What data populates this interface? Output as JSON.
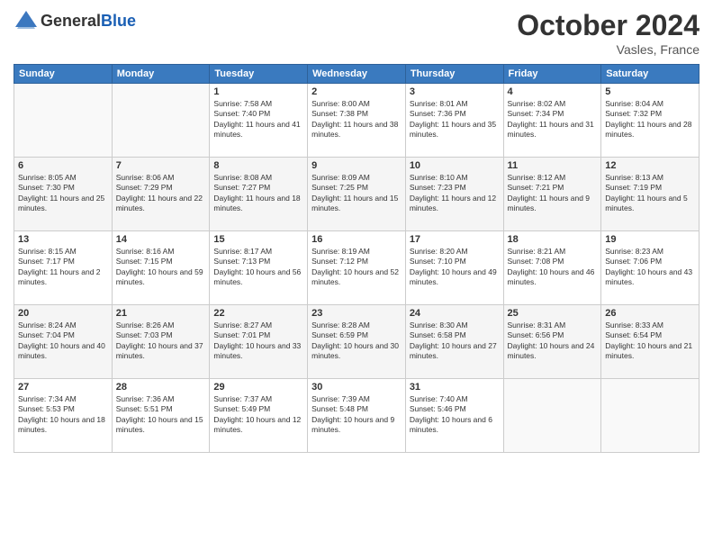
{
  "header": {
    "logo_general": "General",
    "logo_blue": "Blue",
    "month_title": "October 2024",
    "location": "Vasles, France"
  },
  "weekdays": [
    "Sunday",
    "Monday",
    "Tuesday",
    "Wednesday",
    "Thursday",
    "Friday",
    "Saturday"
  ],
  "weeks": [
    [
      {
        "day": "",
        "info": ""
      },
      {
        "day": "",
        "info": ""
      },
      {
        "day": "1",
        "info": "Sunrise: 7:58 AM\nSunset: 7:40 PM\nDaylight: 11 hours and 41 minutes."
      },
      {
        "day": "2",
        "info": "Sunrise: 8:00 AM\nSunset: 7:38 PM\nDaylight: 11 hours and 38 minutes."
      },
      {
        "day": "3",
        "info": "Sunrise: 8:01 AM\nSunset: 7:36 PM\nDaylight: 11 hours and 35 minutes."
      },
      {
        "day": "4",
        "info": "Sunrise: 8:02 AM\nSunset: 7:34 PM\nDaylight: 11 hours and 31 minutes."
      },
      {
        "day": "5",
        "info": "Sunrise: 8:04 AM\nSunset: 7:32 PM\nDaylight: 11 hours and 28 minutes."
      }
    ],
    [
      {
        "day": "6",
        "info": "Sunrise: 8:05 AM\nSunset: 7:30 PM\nDaylight: 11 hours and 25 minutes."
      },
      {
        "day": "7",
        "info": "Sunrise: 8:06 AM\nSunset: 7:29 PM\nDaylight: 11 hours and 22 minutes."
      },
      {
        "day": "8",
        "info": "Sunrise: 8:08 AM\nSunset: 7:27 PM\nDaylight: 11 hours and 18 minutes."
      },
      {
        "day": "9",
        "info": "Sunrise: 8:09 AM\nSunset: 7:25 PM\nDaylight: 11 hours and 15 minutes."
      },
      {
        "day": "10",
        "info": "Sunrise: 8:10 AM\nSunset: 7:23 PM\nDaylight: 11 hours and 12 minutes."
      },
      {
        "day": "11",
        "info": "Sunrise: 8:12 AM\nSunset: 7:21 PM\nDaylight: 11 hours and 9 minutes."
      },
      {
        "day": "12",
        "info": "Sunrise: 8:13 AM\nSunset: 7:19 PM\nDaylight: 11 hours and 5 minutes."
      }
    ],
    [
      {
        "day": "13",
        "info": "Sunrise: 8:15 AM\nSunset: 7:17 PM\nDaylight: 11 hours and 2 minutes."
      },
      {
        "day": "14",
        "info": "Sunrise: 8:16 AM\nSunset: 7:15 PM\nDaylight: 10 hours and 59 minutes."
      },
      {
        "day": "15",
        "info": "Sunrise: 8:17 AM\nSunset: 7:13 PM\nDaylight: 10 hours and 56 minutes."
      },
      {
        "day": "16",
        "info": "Sunrise: 8:19 AM\nSunset: 7:12 PM\nDaylight: 10 hours and 52 minutes."
      },
      {
        "day": "17",
        "info": "Sunrise: 8:20 AM\nSunset: 7:10 PM\nDaylight: 10 hours and 49 minutes."
      },
      {
        "day": "18",
        "info": "Sunrise: 8:21 AM\nSunset: 7:08 PM\nDaylight: 10 hours and 46 minutes."
      },
      {
        "day": "19",
        "info": "Sunrise: 8:23 AM\nSunset: 7:06 PM\nDaylight: 10 hours and 43 minutes."
      }
    ],
    [
      {
        "day": "20",
        "info": "Sunrise: 8:24 AM\nSunset: 7:04 PM\nDaylight: 10 hours and 40 minutes."
      },
      {
        "day": "21",
        "info": "Sunrise: 8:26 AM\nSunset: 7:03 PM\nDaylight: 10 hours and 37 minutes."
      },
      {
        "day": "22",
        "info": "Sunrise: 8:27 AM\nSunset: 7:01 PM\nDaylight: 10 hours and 33 minutes."
      },
      {
        "day": "23",
        "info": "Sunrise: 8:28 AM\nSunset: 6:59 PM\nDaylight: 10 hours and 30 minutes."
      },
      {
        "day": "24",
        "info": "Sunrise: 8:30 AM\nSunset: 6:58 PM\nDaylight: 10 hours and 27 minutes."
      },
      {
        "day": "25",
        "info": "Sunrise: 8:31 AM\nSunset: 6:56 PM\nDaylight: 10 hours and 24 minutes."
      },
      {
        "day": "26",
        "info": "Sunrise: 8:33 AM\nSunset: 6:54 PM\nDaylight: 10 hours and 21 minutes."
      }
    ],
    [
      {
        "day": "27",
        "info": "Sunrise: 7:34 AM\nSunset: 5:53 PM\nDaylight: 10 hours and 18 minutes."
      },
      {
        "day": "28",
        "info": "Sunrise: 7:36 AM\nSunset: 5:51 PM\nDaylight: 10 hours and 15 minutes."
      },
      {
        "day": "29",
        "info": "Sunrise: 7:37 AM\nSunset: 5:49 PM\nDaylight: 10 hours and 12 minutes."
      },
      {
        "day": "30",
        "info": "Sunrise: 7:39 AM\nSunset: 5:48 PM\nDaylight: 10 hours and 9 minutes."
      },
      {
        "day": "31",
        "info": "Sunrise: 7:40 AM\nSunset: 5:46 PM\nDaylight: 10 hours and 6 minutes."
      },
      {
        "day": "",
        "info": ""
      },
      {
        "day": "",
        "info": ""
      }
    ]
  ]
}
